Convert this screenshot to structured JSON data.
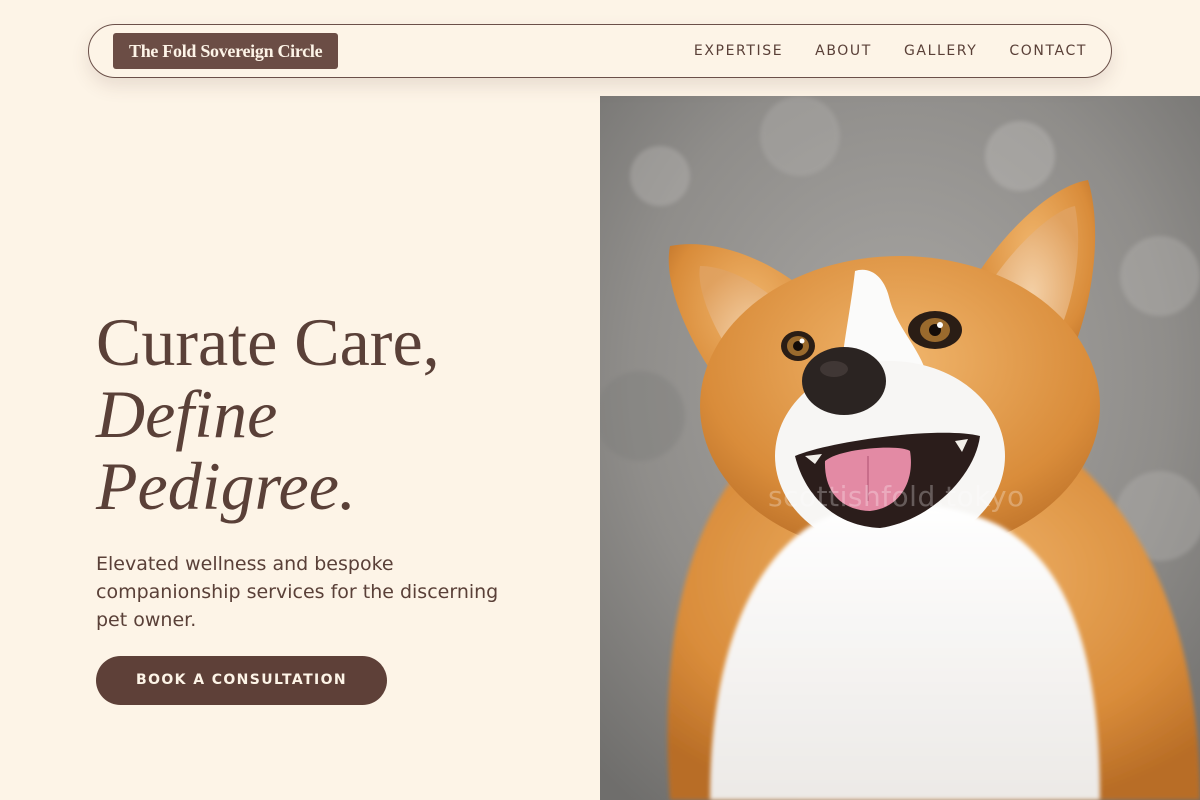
{
  "nav": {
    "brand": "The Fold Sovereign Circle",
    "links": [
      "EXPERTISE",
      "ABOUT",
      "GALLERY",
      "CONTACT"
    ]
  },
  "hero": {
    "line1": "Curate Care,",
    "line2": "Define",
    "line3": "Pedigree.",
    "subtitle": "Elevated wellness and bespoke companionship services for the discerning pet owner.",
    "cta": "BOOK A CONSULTATION"
  },
  "photo": {
    "alt_icon": "corgi-dog-photo",
    "watermark": "scottishfold.tokyo"
  },
  "colors": {
    "background": "#fdf4e7",
    "primary": "#5e4038",
    "text": "#5a4038"
  }
}
